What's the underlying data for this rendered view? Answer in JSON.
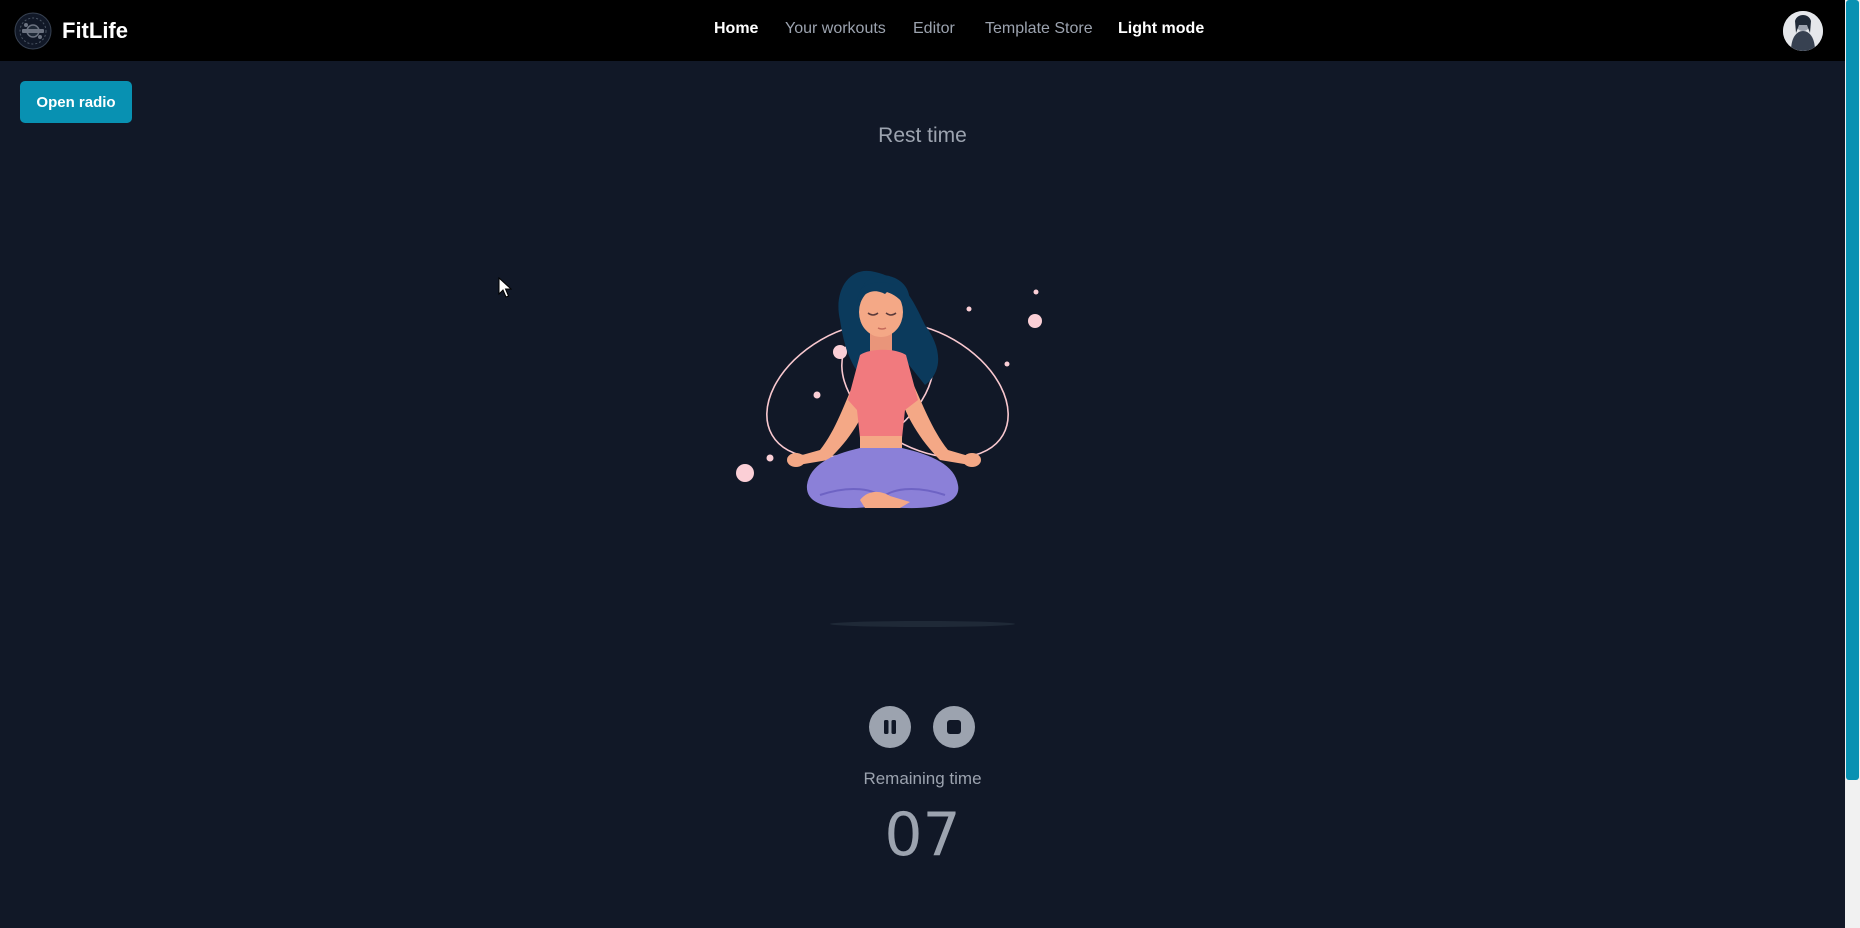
{
  "app": {
    "name": "FitLife"
  },
  "nav": {
    "items": [
      {
        "label": "Home"
      },
      {
        "label": "Your workouts"
      },
      {
        "label": "Editor"
      },
      {
        "label": "Template Store"
      },
      {
        "label": "Light mode"
      }
    ]
  },
  "radio": {
    "label": "Open radio"
  },
  "rest": {
    "title": "Rest time"
  },
  "timer": {
    "remaining_label": "Remaining time",
    "remaining_value": "07"
  },
  "icons": {
    "logo": "fitlife-logo-icon",
    "pause": "pause-icon",
    "stop": "stop-icon",
    "avatar": "avatar"
  },
  "colors": {
    "background": "#111827",
    "navbar": "#000000",
    "accent": "#0891b2",
    "muted_text": "#9ca3af",
    "shirt": "#f17a7e",
    "pants": "#8b80d8",
    "hair": "#0b3a5c"
  }
}
